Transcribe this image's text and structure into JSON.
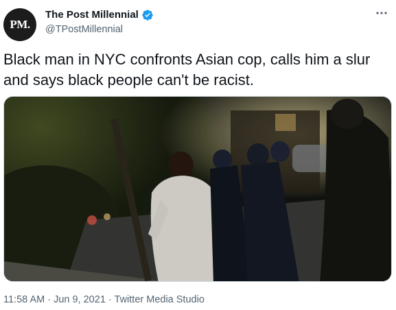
{
  "author": {
    "avatar_text": "PM.",
    "display_name": "The Post Millennial",
    "handle": "@TPostMillennial",
    "verified": true,
    "verified_icon": "verified-badge-icon",
    "more_icon": "more-horizontal-icon"
  },
  "tweet": {
    "text": "Black man in NYC confronts Asian cop, calls him a slur and says black people can't be racist."
  },
  "media": {
    "type": "video-thumbnail"
  },
  "meta": {
    "time": "11:58 AM",
    "separator": " · ",
    "date": "Jun 9, 2021",
    "source": "Twitter Media Studio"
  },
  "colors": {
    "text_primary": "#0f1419",
    "text_secondary": "#536471",
    "verified_blue": "#1d9bf0",
    "border": "#cfd9de"
  }
}
